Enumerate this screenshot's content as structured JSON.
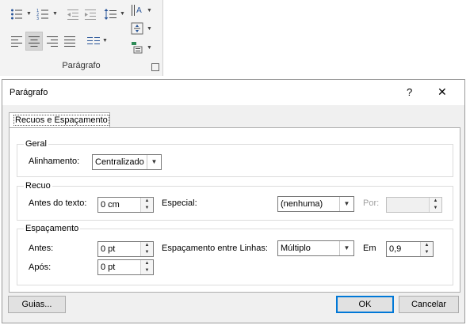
{
  "ribbon": {
    "group_label": "Parágrafo",
    "icons": [
      "bullets-icon",
      "numbering-icon",
      "multilevel-list-icon",
      "decrease-indent-icon",
      "increase-indent-icon",
      "line-spacing-icon",
      "text-direction-icon",
      "align-text-icon",
      "convert-to-smartart-icon",
      "align-left-icon",
      "align-center-icon",
      "align-right-icon",
      "justify-icon",
      "columns-icon"
    ]
  },
  "dialog": {
    "title": "Parágrafo",
    "help": "?",
    "close": "✕",
    "tab": "Recuos e Espaçamento",
    "geral": {
      "legend": "Geral",
      "alinhamento_label": "Alinhamento:",
      "alinhamento_value": "Centralizado"
    },
    "recuo": {
      "legend": "Recuo",
      "antes_label": "Antes do texto:",
      "antes_value": "0 cm",
      "especial_label": "Especial:",
      "especial_value": "(nenhuma)",
      "por_label": "Por:",
      "por_value": ""
    },
    "espacamento": {
      "legend": "Espaçamento",
      "antes_label": "Antes:",
      "antes_value": "0 pt",
      "apos_label": "Após:",
      "apos_value": "0 pt",
      "entre_linhas_label": "Espaçamento entre Linhas:",
      "entre_linhas_value": "Múltiplo",
      "em_label": "Em",
      "em_value": "0,9"
    },
    "buttons": {
      "guias": "Guias...",
      "ok": "OK",
      "cancelar": "Cancelar"
    }
  }
}
